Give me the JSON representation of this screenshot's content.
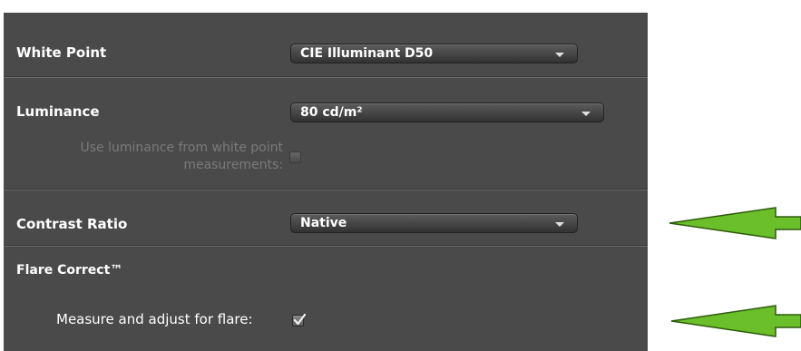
{
  "white_point": {
    "label": "White Point",
    "value": "CIE Illuminant D50"
  },
  "luminance": {
    "label": "Luminance",
    "value": "80 cd/m²"
  },
  "use_luminance": {
    "label_line1": "Use luminance from white point",
    "label_line2": "measurements:",
    "checked": false
  },
  "contrast_ratio": {
    "label": "Contrast Ratio",
    "value": "Native"
  },
  "flare": {
    "heading": "Flare Correct™",
    "measure_label": "Measure and adjust for flare:",
    "checked": true
  },
  "colors": {
    "panel_bg": "#4a4a4a",
    "arrow_fill": "#6bbf2a",
    "arrow_stroke": "#2d5a0e"
  }
}
